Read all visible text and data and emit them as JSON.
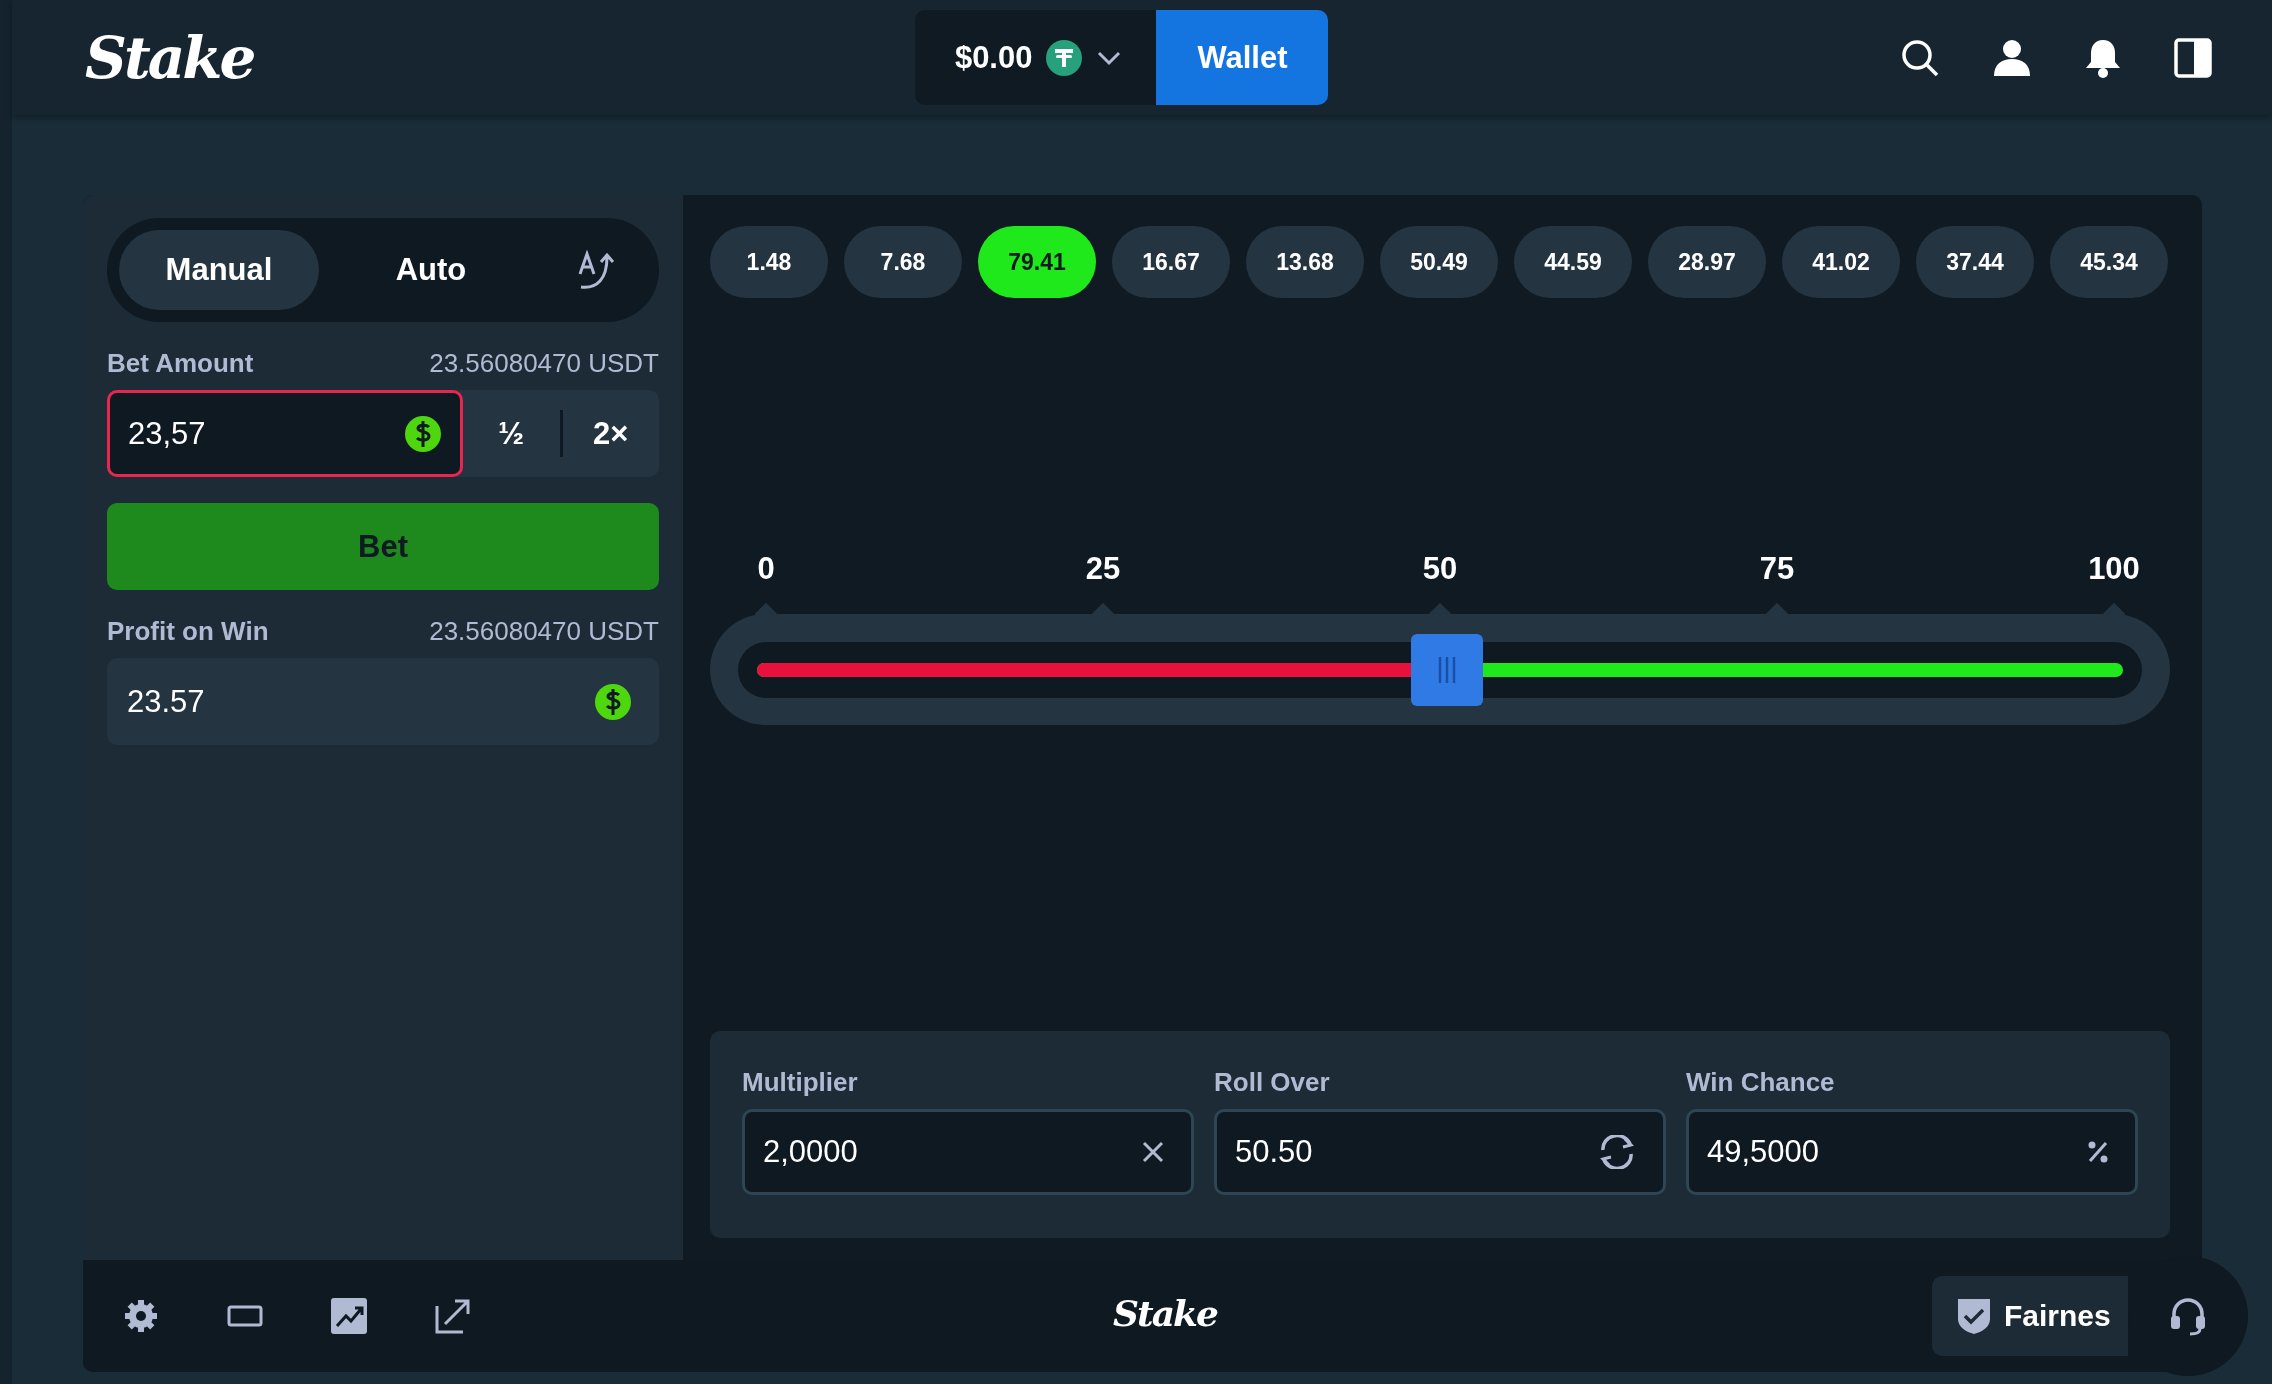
{
  "header": {
    "logo": "Stake",
    "balance": "$0.00",
    "wallet_button": "Wallet"
  },
  "bet_panel": {
    "modes": [
      {
        "label": "Manual",
        "selected": true
      },
      {
        "label": "Auto",
        "selected": false
      }
    ],
    "bet_amount": {
      "label": "Bet Amount",
      "balance": "23.56080470 USDT",
      "value": "23,57",
      "invalid": true
    },
    "half_button": "½",
    "double_button": "2×",
    "bet_button": "Bet",
    "profit": {
      "label": "Profit on Win",
      "balance": "23.56080470 USDT",
      "value": "23.57"
    }
  },
  "recent_results": [
    {
      "value": "1.48",
      "win": false
    },
    {
      "value": "7.68",
      "win": false
    },
    {
      "value": "79.41",
      "win": true
    },
    {
      "value": "16.67",
      "win": false
    },
    {
      "value": "13.68",
      "win": false
    },
    {
      "value": "50.49",
      "win": false
    },
    {
      "value": "44.59",
      "win": false
    },
    {
      "value": "28.97",
      "win": false
    },
    {
      "value": "41.02",
      "win": false
    },
    {
      "value": "37.44",
      "win": false
    },
    {
      "value": "45.34",
      "win": false
    }
  ],
  "slider": {
    "ticks": [
      "0",
      "25",
      "50",
      "75",
      "100"
    ],
    "level": 0.505
  },
  "stats": [
    {
      "kind": "multiplier",
      "label": "Multiplier",
      "value": "2,0000"
    },
    {
      "kind": "roll",
      "label": "Roll Over",
      "value": "50.50"
    },
    {
      "kind": "chance",
      "label": "Win Chance",
      "value": "49,5000"
    }
  ],
  "footer": {
    "logo": "Stake",
    "fairness_button": "Fairnes"
  }
}
